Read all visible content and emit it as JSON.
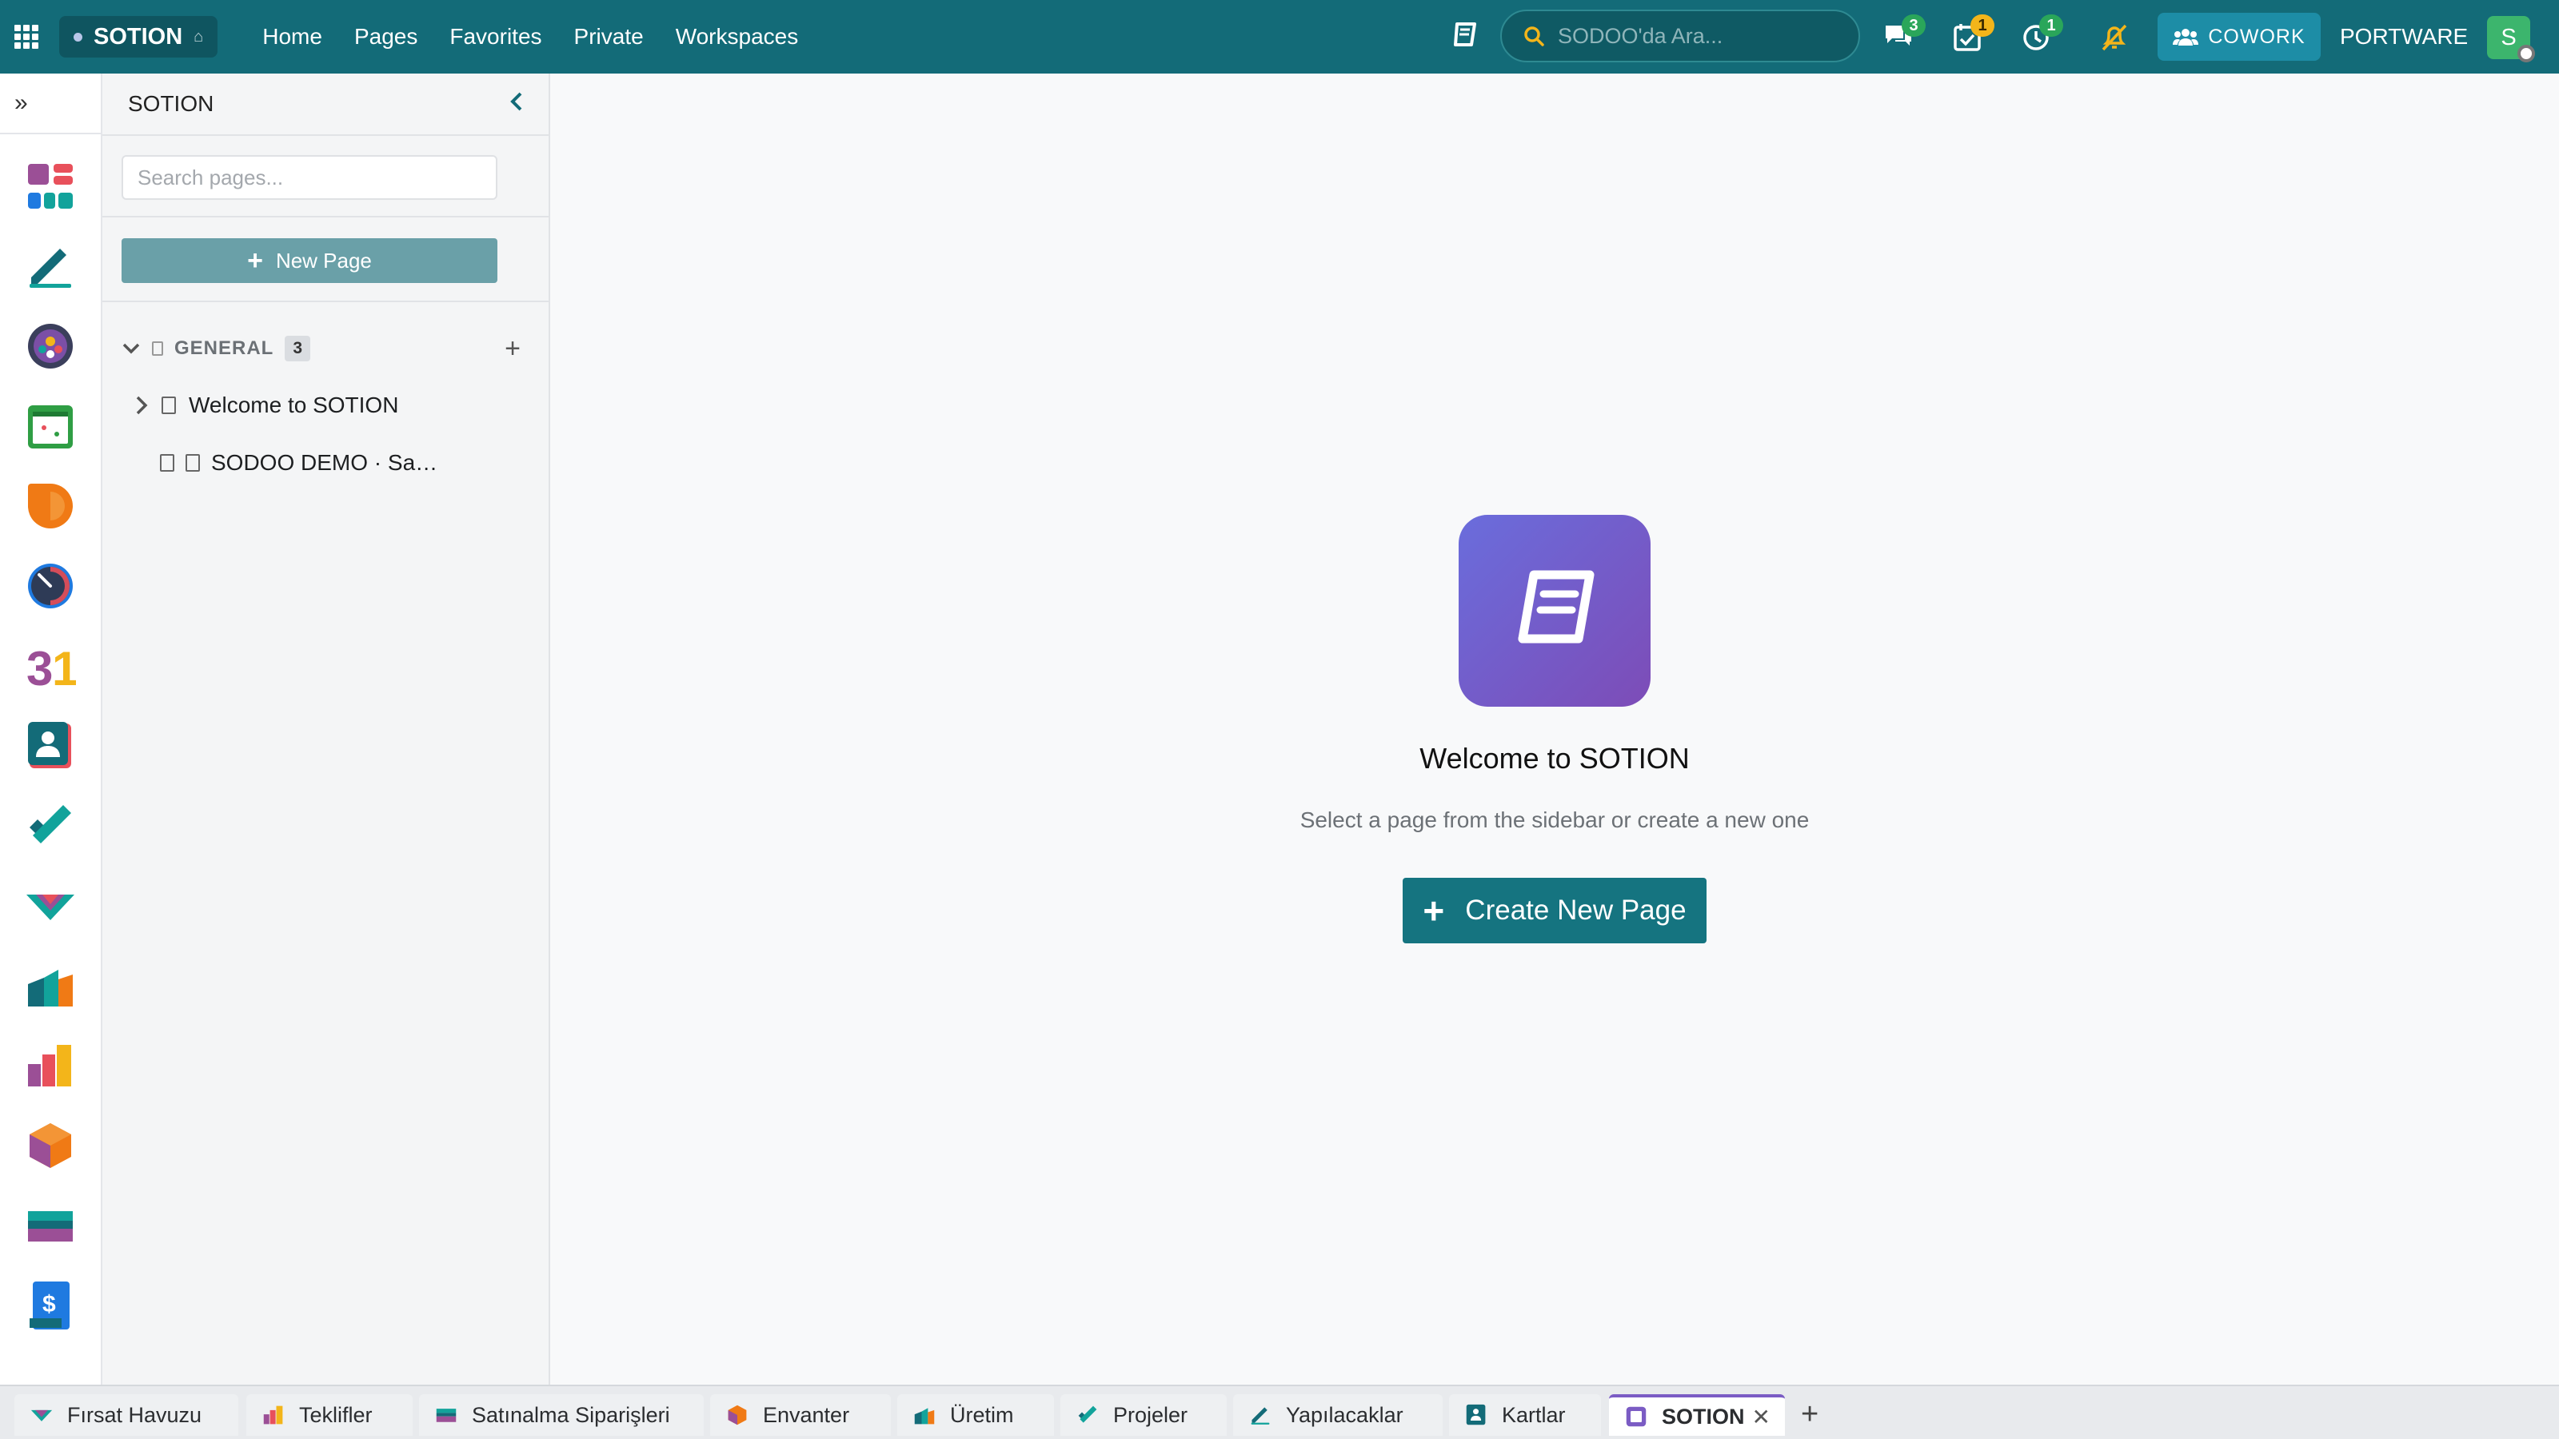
{
  "topbar": {
    "brand": "SOTION",
    "nav": [
      "Home",
      "Pages",
      "Favorites",
      "Private",
      "Workspaces"
    ],
    "search_placeholder": "SODOO'da Ara...",
    "messages_badge": "3",
    "activities_badge": "1",
    "timer_badge": "1",
    "cowork_label": "COWORK",
    "company": "PORTWARE",
    "avatar_initial": "S"
  },
  "sidebar": {
    "title": "SOTION",
    "search_placeholder": "Search pages...",
    "new_page_label": "New Page",
    "section": {
      "name": "GENERAL",
      "count": "3"
    },
    "pages": [
      {
        "title": "Welcome to SOTION"
      },
      {
        "title": "SODOO DEMO · Sa…"
      }
    ]
  },
  "main": {
    "title": "Welcome to SOTION",
    "subtitle": "Select a page from the sidebar or create a new one",
    "create_label": "Create New Page"
  },
  "tabs": [
    {
      "label": "Fırsat Havuzu",
      "icon": "crm-icon"
    },
    {
      "label": "Teklifler",
      "icon": "sales-icon"
    },
    {
      "label": "Satınalma Siparişleri",
      "icon": "purchase-icon"
    },
    {
      "label": "Envanter",
      "icon": "inventory-icon"
    },
    {
      "label": "Üretim",
      "icon": "manufacturing-icon"
    },
    {
      "label": "Projeler",
      "icon": "project-icon"
    },
    {
      "label": "Yapılacaklar",
      "icon": "todo-icon"
    },
    {
      "label": "Kartlar",
      "icon": "contacts-icon"
    },
    {
      "label": "SOTION",
      "icon": "sotion-icon",
      "active": true
    }
  ],
  "colors": {
    "topbar": "#136b78",
    "accent": "#157480",
    "tab_active": "#7b5cc4"
  }
}
